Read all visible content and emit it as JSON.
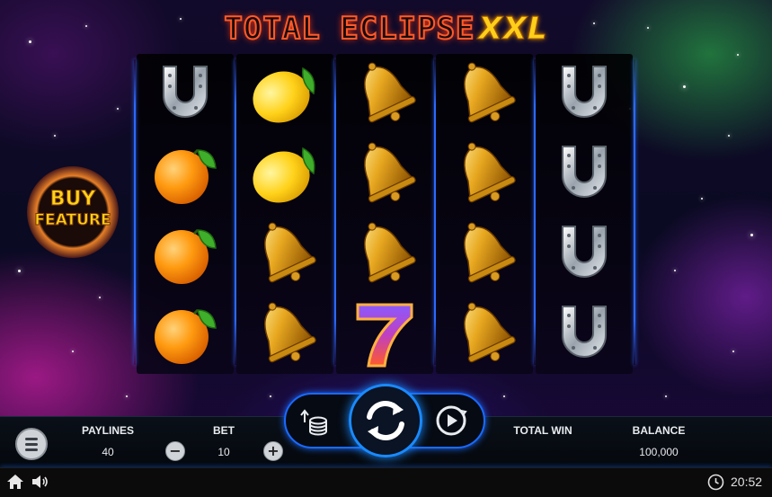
{
  "game": {
    "title_main": "TOTAL ECLIPSE",
    "title_suffix": "XXL"
  },
  "buy_feature": {
    "line1": "BUY",
    "line2": "FEATURE"
  },
  "reels": [
    [
      "horseshoe",
      "orange",
      "orange",
      "orange"
    ],
    [
      "lemon",
      "lemon",
      "bell",
      "bell"
    ],
    [
      "bell",
      "bell",
      "bell",
      "seven"
    ],
    [
      "bell",
      "bell",
      "bell",
      "bell"
    ],
    [
      "horseshoe",
      "horseshoe",
      "horseshoe",
      "horseshoe"
    ]
  ],
  "hud": {
    "paylines_label": "PAYLINES",
    "paylines_value": "40",
    "bet_label": "BET",
    "bet_value": "10",
    "total_win_label": "TOTAL WIN",
    "total_win_value": "",
    "balance_label": "BALANCE",
    "balance_value": "100,000",
    "minus_symbol": "−",
    "plus_symbol": "+"
  },
  "icons": {
    "menu": "menu-icon",
    "stake": "coin-stack-icon",
    "spin": "spin-icon",
    "autoplay": "autoplay-icon",
    "home": "home-icon",
    "sound": "speaker-icon",
    "clock": "clock-icon"
  },
  "system": {
    "time": "20:52"
  },
  "colors": {
    "accent_blue": "#1a6aff",
    "title_orange": "#ff5a2a",
    "title_gold": "#ffcf1a"
  }
}
